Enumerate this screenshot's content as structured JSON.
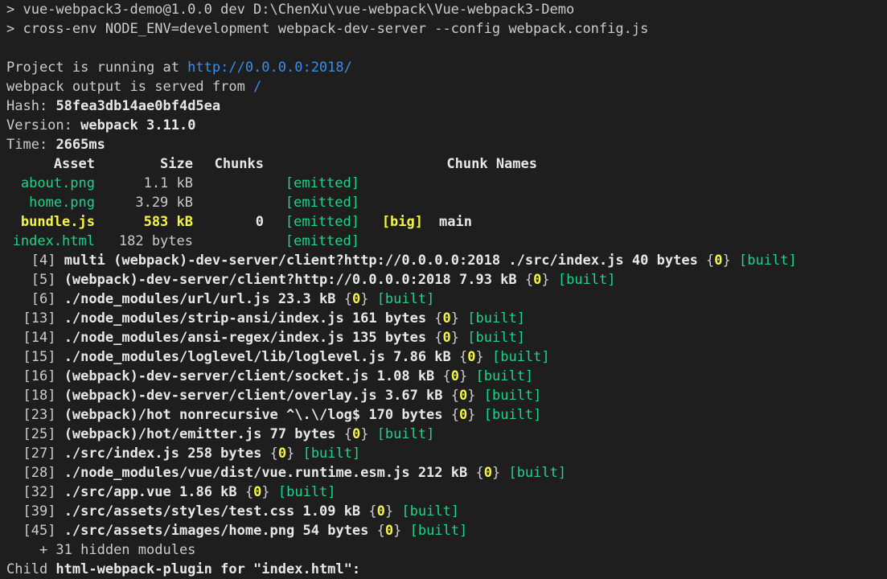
{
  "colors": {
    "background": "#1e1e1e",
    "text": "#cccccc",
    "link": "#3b8eea",
    "green": "#23d18b",
    "yellow": "#f5f543"
  },
  "script_lines": [
    "> vue-webpack3-demo@1.0.0 dev D:\\ChenXu\\vue-webpack\\Vue-webpack3-Demo",
    "> cross-env NODE_ENV=development webpack-dev-server --config webpack.config.js"
  ],
  "running": {
    "prefix": "Project is running at ",
    "url": "http://0.0.0.0:2018/"
  },
  "served": {
    "prefix": "webpack output is served from ",
    "path": "/"
  },
  "hash": {
    "label": "Hash:",
    "value": "58fea3db14ae0bf4d5ea"
  },
  "version": {
    "label": "Version:",
    "value": "webpack 3.11.0"
  },
  "time": {
    "label": "Time:",
    "value": "2665ms"
  },
  "asset_table": {
    "headers": {
      "asset": "Asset",
      "size": "Size",
      "chunks": "Chunks",
      "chunk_names": "Chunk Names"
    },
    "rows": [
      {
        "asset": "about.png",
        "size": "1.1 kB",
        "chunks": "",
        "status": "[emitted]",
        "flag": "",
        "name": "",
        "highlight": false
      },
      {
        "asset": "home.png",
        "size": "3.29 kB",
        "chunks": "",
        "status": "[emitted]",
        "flag": "",
        "name": "",
        "highlight": false
      },
      {
        "asset": "bundle.js",
        "size": "583 kB",
        "chunks": "0",
        "status": "[emitted]",
        "flag": "[big]",
        "name": "main",
        "highlight": true
      },
      {
        "asset": "index.html",
        "size": "182 bytes",
        "chunks": "",
        "status": "[emitted]",
        "flag": "",
        "name": "",
        "highlight": false
      }
    ]
  },
  "modules": [
    {
      "id": "[4]",
      "path": "multi (webpack)-dev-server/client?http://0.0.0.0:2018 ./src/index.js",
      "size": "40 bytes",
      "chunk": "0",
      "status": "[built]"
    },
    {
      "id": "[5]",
      "path": "(webpack)-dev-server/client?http://0.0.0.0:2018",
      "size": "7.93 kB",
      "chunk": "0",
      "status": "[built]"
    },
    {
      "id": "[6]",
      "path": "./node_modules/url/url.js",
      "size": "23.3 kB",
      "chunk": "0",
      "status": "[built]"
    },
    {
      "id": "[13]",
      "path": "./node_modules/strip-ansi/index.js",
      "size": "161 bytes",
      "chunk": "0",
      "status": "[built]"
    },
    {
      "id": "[14]",
      "path": "./node_modules/ansi-regex/index.js",
      "size": "135 bytes",
      "chunk": "0",
      "status": "[built]"
    },
    {
      "id": "[15]",
      "path": "./node_modules/loglevel/lib/loglevel.js",
      "size": "7.86 kB",
      "chunk": "0",
      "status": "[built]"
    },
    {
      "id": "[16]",
      "path": "(webpack)-dev-server/client/socket.js",
      "size": "1.08 kB",
      "chunk": "0",
      "status": "[built]"
    },
    {
      "id": "[18]",
      "path": "(webpack)-dev-server/client/overlay.js",
      "size": "3.67 kB",
      "chunk": "0",
      "status": "[built]"
    },
    {
      "id": "[23]",
      "path": "(webpack)/hot nonrecursive ^\\.\\/log$",
      "size": "170 bytes",
      "chunk": "0",
      "status": "[built]"
    },
    {
      "id": "[25]",
      "path": "(webpack)/hot/emitter.js",
      "size": "77 bytes",
      "chunk": "0",
      "status": "[built]"
    },
    {
      "id": "[27]",
      "path": "./src/index.js",
      "size": "258 bytes",
      "chunk": "0",
      "status": "[built]"
    },
    {
      "id": "[28]",
      "path": "./node_modules/vue/dist/vue.runtime.esm.js",
      "size": "212 kB",
      "chunk": "0",
      "status": "[built]"
    },
    {
      "id": "[32]",
      "path": "./src/app.vue",
      "size": "1.86 kB",
      "chunk": "0",
      "status": "[built]"
    },
    {
      "id": "[39]",
      "path": "./src/assets/styles/test.css",
      "size": "1.09 kB",
      "chunk": "0",
      "status": "[built]"
    },
    {
      "id": "[45]",
      "path": "./src/assets/images/home.png",
      "size": "54 bytes",
      "chunk": "0",
      "status": "[built]"
    }
  ],
  "hidden_modules": "+ 31 hidden modules",
  "child": {
    "prefix": "Child ",
    "name": "html-webpack-plugin for \"index.html\":"
  }
}
